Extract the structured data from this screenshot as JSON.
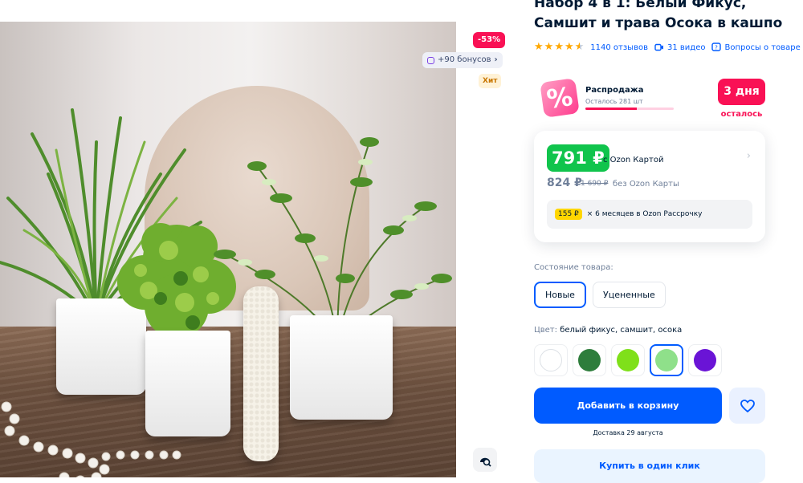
{
  "product": {
    "title": "Набор 4 в 1: Белый Фикус, Самшит и трава Осока в кашпо",
    "image_alt": "Искусственные растения в белых кашпо"
  },
  "badges": {
    "discount": "-53%",
    "bonus": "+90 бонусов",
    "hit": "Хит"
  },
  "meta": {
    "rating": 4.5,
    "reviews": "1140 отзывов",
    "videos": "31 видео",
    "questions": "Вопросы о товаре"
  },
  "sale": {
    "percent_icon": "%",
    "title": "Распродажа",
    "remaining": "Осталось 281 шт",
    "remaining_fraction": 0.58,
    "days_value": "3 дня",
    "days_caption": "осталось"
  },
  "price": {
    "ozon_card_price": "791 ₽",
    "ozon_card_label": "с Ozon Картой",
    "regular_price": "824 ₽",
    "old_price": "1 690 ₽",
    "without_card_label": "без Ozon Карты",
    "installment_amount": "155 ₽",
    "installment_text": "× 6 месяцев в Ozon Рассрочку"
  },
  "condition": {
    "label": "Состояние товара:",
    "options": [
      "Новые",
      "Уцененные"
    ],
    "selected": "Новые"
  },
  "color": {
    "label": "Цвет:",
    "value": "белый фикус, самшит, осока",
    "swatches": [
      {
        "name": "white",
        "color": "#ffffff"
      },
      {
        "name": "dark-green",
        "color": "#2e7d3c"
      },
      {
        "name": "lime",
        "color": "#7fe01a"
      },
      {
        "name": "light-green",
        "color": "#8fe08a"
      },
      {
        "name": "purple",
        "color": "#6a14d6"
      }
    ],
    "selected_index": 3
  },
  "actions": {
    "add_to_cart": "Добавить в корзину",
    "delivery": "Доставка 29 августа",
    "buy_one_click": "Купить в один клик"
  },
  "icons": {
    "star": "★",
    "chevron": "›",
    "card_chevron": "›"
  },
  "colors": {
    "brand_blue": "#005bff",
    "sale_pink": "#f91155",
    "ozon_green": "#10c44c"
  }
}
